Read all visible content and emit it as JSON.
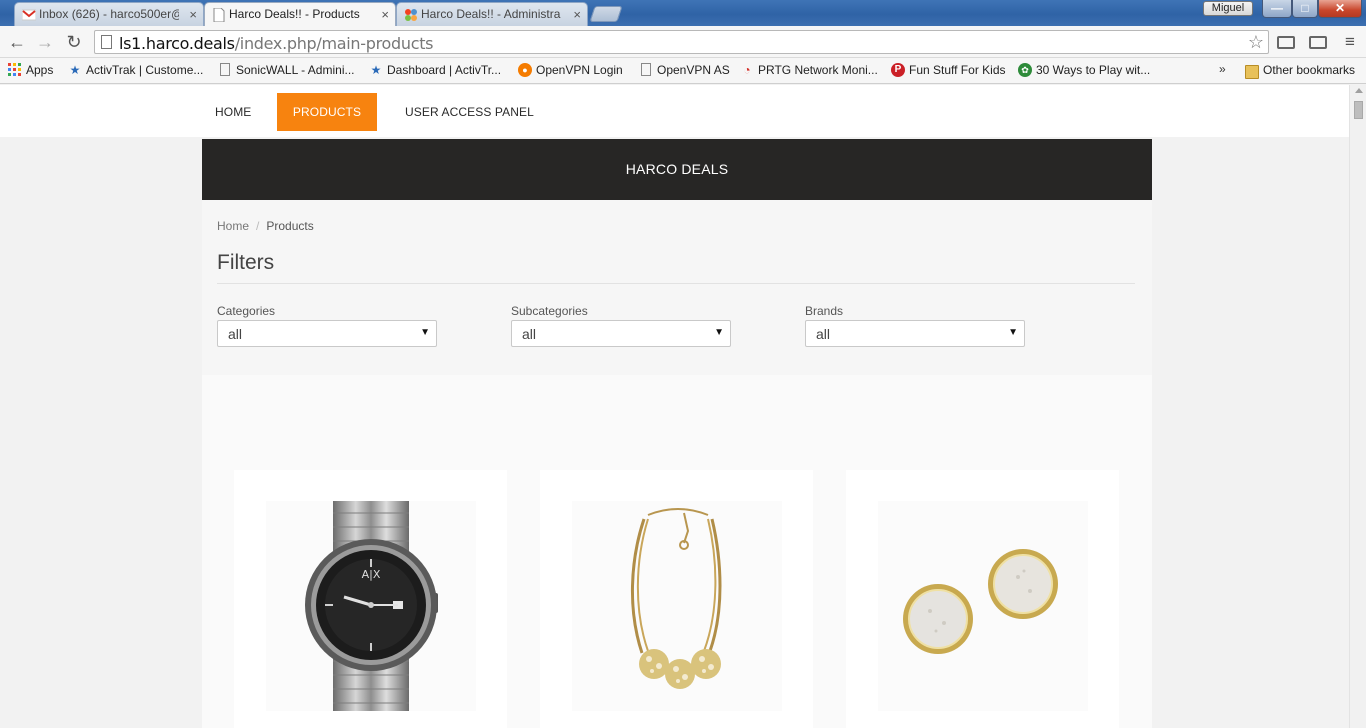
{
  "browser": {
    "tabs": [
      {
        "title": "Inbox (626) - harco500er@",
        "active": false
      },
      {
        "title": "Harco Deals!! - Products",
        "active": true
      },
      {
        "title": "Harco Deals!! - Administra",
        "active": false
      }
    ],
    "profile_name": "Miguel",
    "window_controls": {
      "minimize": "—",
      "maximize": "□",
      "close": "✕"
    },
    "url": {
      "host": "ls1.harco.deals",
      "path": "/index.php/main-products"
    },
    "bookmarks": [
      {
        "label": "Apps",
        "icon": "apps-grid-icon"
      },
      {
        "label": "ActivTrak | Custome...",
        "icon": "activtrak-icon"
      },
      {
        "label": "SonicWALL - Admini...",
        "icon": "page-icon"
      },
      {
        "label": "Dashboard | ActivTr...",
        "icon": "activtrak-icon"
      },
      {
        "label": "OpenVPN Login",
        "icon": "openvpn-icon"
      },
      {
        "label": "OpenVPN AS",
        "icon": "page-icon"
      },
      {
        "label": "PRTG Network Moni...",
        "icon": "prtg-icon"
      },
      {
        "label": "Fun Stuff For Kids",
        "icon": "pinterest-icon"
      },
      {
        "label": "30 Ways to Play wit...",
        "icon": "leaf-icon"
      }
    ],
    "bookmarks_overflow": "»",
    "other_bookmarks": "Other bookmarks"
  },
  "site": {
    "nav": [
      {
        "label": "HOME",
        "active": false
      },
      {
        "label": "PRODUCTS",
        "active": true
      },
      {
        "label": "USER ACCESS PANEL",
        "active": false
      }
    ],
    "brand": "HARCO DEALS",
    "breadcrumb": {
      "home": "Home",
      "separator": "/",
      "current": "Products"
    },
    "filters_title": "Filters",
    "filters": [
      {
        "label": "Categories",
        "value": "all"
      },
      {
        "label": "Subcategories",
        "value": "all"
      },
      {
        "label": "Brands",
        "value": "all"
      }
    ],
    "products": [
      {
        "image": "wristwatch-image"
      },
      {
        "image": "necklace-image"
      },
      {
        "image": "stud-earrings-image"
      }
    ]
  },
  "colors": {
    "accent": "#f7830f",
    "header_bg": "#272625",
    "titlebar": "#2f63a6"
  }
}
